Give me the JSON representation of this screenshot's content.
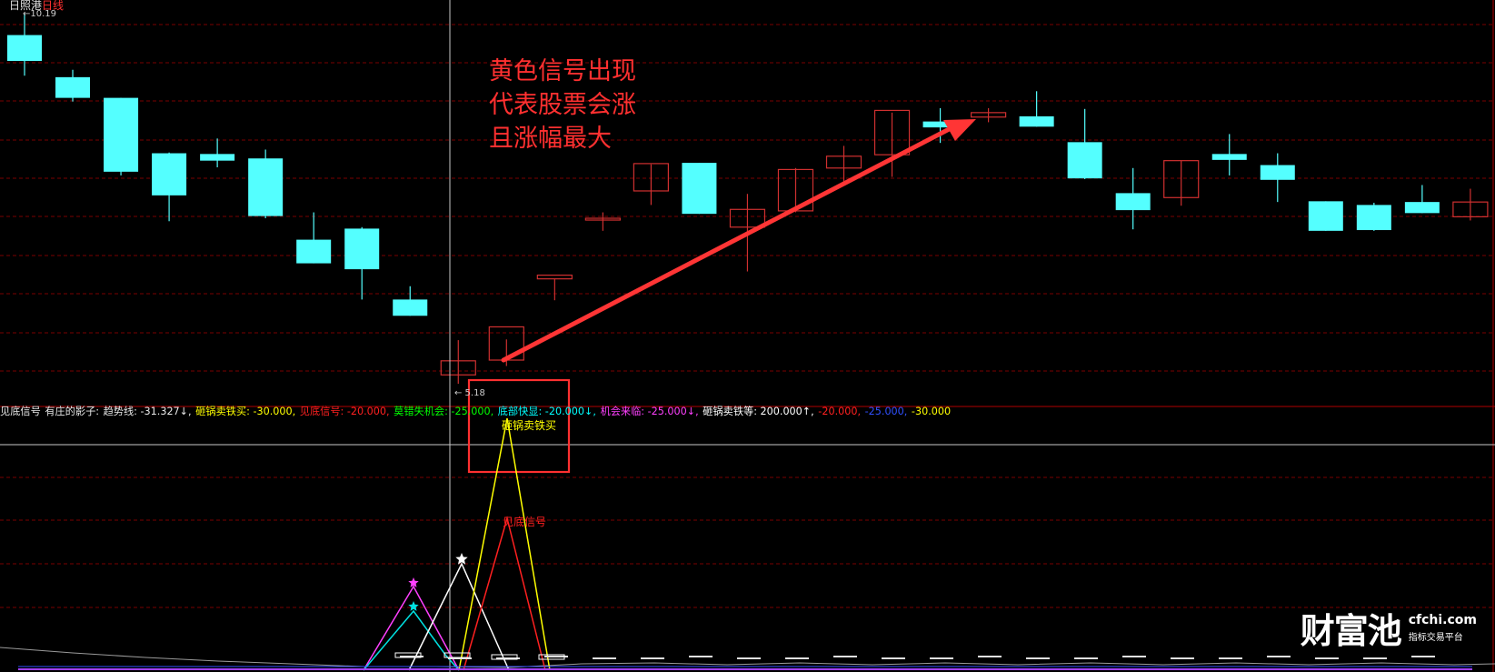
{
  "title": {
    "stock_name": "日照港",
    "period": "日线"
  },
  "price_labels": {
    "high_marker": "←10.19",
    "low_marker": "← 5.18"
  },
  "annotation": {
    "lines": [
      "黄色信号出现",
      "代表股票会涨",
      "且涨幅最大"
    ],
    "color": "#ff3030"
  },
  "indicator_legend": [
    {
      "text": "见底信号",
      "color": "#e8e8e8"
    },
    {
      "text": "有庄的影子:",
      "color": "#e8e8e8"
    },
    {
      "text": "趋势线: -31.327↓,",
      "color": "#e8e8e8"
    },
    {
      "text": "砸锅卖铁买: -30.000,",
      "color": "#ffff00"
    },
    {
      "text": "见底信号: -20.000,",
      "color": "#ff2020"
    },
    {
      "text": "莫错失机会: -25.000,",
      "color": "#00ff00"
    },
    {
      "text": "底部快显: -20.000↓,",
      "color": "#00ffff"
    },
    {
      "text": "机会来临: -25.000↓,",
      "color": "#ff40ff"
    },
    {
      "text": "砸锅卖铁等: 200.000↑,",
      "color": "#ffffff"
    },
    {
      "text": "-20.000,",
      "color": "#ff2020"
    },
    {
      "text": "-25.000,",
      "color": "#3050ff"
    },
    {
      "text": "-30.000",
      "color": "#ffff00"
    }
  ],
  "signal_labels": {
    "buy": "砸锅卖铁买",
    "bottom": "见底信号"
  },
  "watermark": {
    "main": "财富池",
    "url": "cfchi.com",
    "sub": "指标交易平台"
  },
  "colors": {
    "up_candle": "#d03030",
    "down_candle": "#54ffff",
    "grid": "#7a0000",
    "crosshair": "#c8c8c8",
    "arrow": "#ff3535"
  },
  "candles": [
    {
      "o": 9.9,
      "h": 10.19,
      "l": 9.35,
      "c": 9.55
    },
    {
      "o": 9.33,
      "h": 9.43,
      "l": 9.0,
      "c": 9.05
    },
    {
      "o": 9.05,
      "h": 9.05,
      "l": 8.0,
      "c": 8.05
    },
    {
      "o": 8.3,
      "h": 8.31,
      "l": 7.38,
      "c": 7.73
    },
    {
      "o": 8.29,
      "h": 8.5,
      "l": 8.11,
      "c": 8.2
    },
    {
      "o": 8.23,
      "h": 8.35,
      "l": 7.42,
      "c": 7.45
    },
    {
      "o": 7.13,
      "h": 7.5,
      "l": 6.81,
      "c": 6.81
    },
    {
      "o": 7.28,
      "h": 7.3,
      "l": 6.32,
      "c": 6.73
    },
    {
      "o": 6.32,
      "h": 6.5,
      "l": 6.1,
      "c": 6.1
    },
    {
      "o": 5.3,
      "h": 5.77,
      "l": 5.18,
      "c": 5.49
    },
    {
      "o": 5.5,
      "h": 5.78,
      "l": 5.42,
      "c": 5.95
    },
    {
      "o": 6.6,
      "h": 6.6,
      "l": 6.31,
      "c": 6.65
    },
    {
      "o": 7.41,
      "h": 7.5,
      "l": 7.25,
      "c": 7.42
    },
    {
      "o": 7.79,
      "h": 8.15,
      "l": 7.6,
      "c": 8.16
    },
    {
      "o": 8.17,
      "h": 8.17,
      "l": 7.48,
      "c": 7.48
    },
    {
      "o": 7.3,
      "h": 7.75,
      "l": 6.7,
      "c": 7.54
    },
    {
      "o": 7.52,
      "h": 8.1,
      "l": 7.5,
      "c": 8.08
    },
    {
      "o": 8.1,
      "h": 8.4,
      "l": 7.9,
      "c": 8.26
    },
    {
      "o": 8.28,
      "h": 8.85,
      "l": 7.98,
      "c": 8.88
    },
    {
      "o": 8.73,
      "h": 8.91,
      "l": 8.44,
      "c": 8.65
    },
    {
      "o": 8.79,
      "h": 8.91,
      "l": 8.72,
      "c": 8.85
    },
    {
      "o": 8.8,
      "h": 9.14,
      "l": 8.66,
      "c": 8.66
    },
    {
      "o": 8.45,
      "h": 8.9,
      "l": 7.95,
      "c": 7.96
    },
    {
      "o": 7.76,
      "h": 8.1,
      "l": 7.27,
      "c": 7.53
    },
    {
      "o": 7.7,
      "h": 8.2,
      "l": 7.59,
      "c": 8.2
    },
    {
      "o": 8.29,
      "h": 8.56,
      "l": 8.0,
      "c": 8.21
    },
    {
      "o": 8.14,
      "h": 8.3,
      "l": 7.64,
      "c": 7.94
    },
    {
      "o": 7.65,
      "h": 7.65,
      "l": 7.25,
      "c": 7.25
    },
    {
      "o": 7.6,
      "h": 7.63,
      "l": 7.25,
      "c": 7.26
    },
    {
      "o": 7.64,
      "h": 7.87,
      "l": 7.49,
      "c": 7.49
    },
    {
      "o": 7.44,
      "h": 7.82,
      "l": 7.39,
      "c": 7.64
    }
  ]
}
